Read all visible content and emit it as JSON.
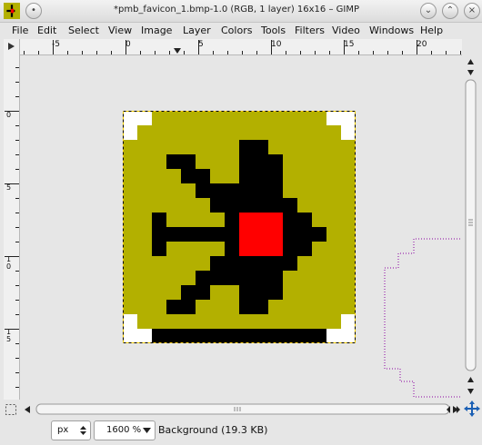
{
  "window": {
    "title": "*pmb_favicon_1.bmp-1.0 (RGB, 1 layer) 16x16 – GIMP",
    "menu_btn": "•",
    "minimize_btn": "⌄",
    "maximize_btn": "⌃",
    "close_btn": "×"
  },
  "menu": {
    "file": "File",
    "edit": "Edit",
    "select": "Select",
    "view": "View",
    "image": "Image",
    "layer": "Layer",
    "colors": "Colors",
    "tools": "Tools",
    "filters": "Filters",
    "video": "Video",
    "windows": "Windows",
    "help": "Help"
  },
  "hruler": {
    "m5": "-5",
    "z": "0",
    "p5": "5",
    "p10": "10",
    "p15": "15",
    "p20": "20"
  },
  "vruler": {
    "z": "0",
    "p5": "5",
    "p10": "10",
    "p15": "15"
  },
  "status": {
    "unit": "px",
    "zoom": "1600 %",
    "layer_info": "Background (19.3 KB)"
  },
  "colors": {
    "canvas_bg": "#e6e6e6",
    "olive": "#b3b000",
    "black": "#000000",
    "red": "#ff0000",
    "white": "#ffffff",
    "selection_dash": "#8a00a0"
  },
  "image_pixels": [
    "WWOOOOOOOOOOOOWW",
    "WOOOOOOOOOOOOOOW",
    "OOOOOOOOKKOOOOOO",
    "OOOKKOOOKKKOOOOO",
    "OOOOKKOOKKKOOOOO",
    "OOOOOKKKKKKOOOOO",
    "OOOOOOKKKKKKOOOO",
    "OOKOOOOKRRRKKOOO",
    "OOKKKKKKRRRKKKOO",
    "OOKOOOOKRRRKKOOO",
    "OOOOOOKKKKKKOOOO",
    "OOOOOKKKKKKOOOOO",
    "OOOOKKOOKKKOOOOO",
    "OOOKKOOOKKOOOOOO",
    "WOOOOOOOOOOOOOOW",
    "WWKKKKKKKKKKKKWW"
  ]
}
